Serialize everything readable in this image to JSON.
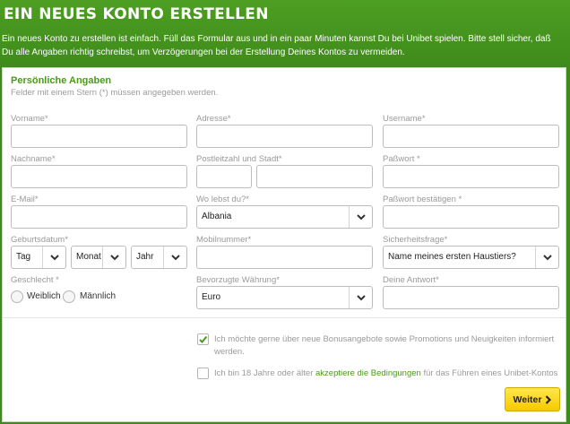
{
  "header": {
    "title": "EIN NEUES KONTO ERSTELLEN",
    "intro": "Ein neues Konto zu erstellen ist einfach. Füll das Formular aus und in ein paar Minuten kannst Du bei Unibet spielen. Bitte stell sicher, daß Du alle Angaben richtig schreibst, um Verzögerungen bei der Erstellung Deines Kontos zu vermeiden."
  },
  "section": {
    "title": "Persönliche Angaben",
    "hint": "Felder mit einem Stern (*) müssen angegeben werden."
  },
  "fields": {
    "vorname": "Vorname*",
    "nachname": "Nachname*",
    "email": "E-Mail*",
    "geburtsdatum": "Geburtsdatum*",
    "geschlecht": "Geschlecht *",
    "adresse": "Adresse*",
    "plz_stadt": "Postleitzahl und Stadt*",
    "wohnort": "Wo lebst du?*",
    "mobil": "Mobilnummer*",
    "waehrung": "Bevorzugte Währung*",
    "username": "Username*",
    "passwort": "Paßwort *",
    "passwort_bestaetigen": "Paßwort bestätigen *",
    "sicherheitsfrage": "Sicherheitsfrage*",
    "antwort": "Deine Antwort*"
  },
  "selects": {
    "day": "Tag",
    "month": "Monat",
    "year": "Jahr",
    "country": "Albania",
    "currency": "Euro",
    "security_question": "Name meines ersten Haustiers?"
  },
  "gender": {
    "female": "Weiblich",
    "male": "Männlich"
  },
  "consent": {
    "promo": "Ich möchte gerne über neue Bonusangebote sowie Promotions und Neuigkeiten informiert werden.",
    "promo_checked": true,
    "terms_pre": "Ich bin 18 Jahre oder älter ",
    "terms_link": "akzeptiere die Bedingungen",
    "terms_post": " für das Führen eines Unibet-Kontos",
    "terms_checked": false
  },
  "actions": {
    "next": "Weiter"
  },
  "colors": {
    "brand_green": "#4a9a1d",
    "button_yellow": "#f7c900"
  },
  "icons": {
    "select_arrow": "chevron-down-icon",
    "next_arrow": "chevron-right-icon",
    "check": "check-icon"
  }
}
